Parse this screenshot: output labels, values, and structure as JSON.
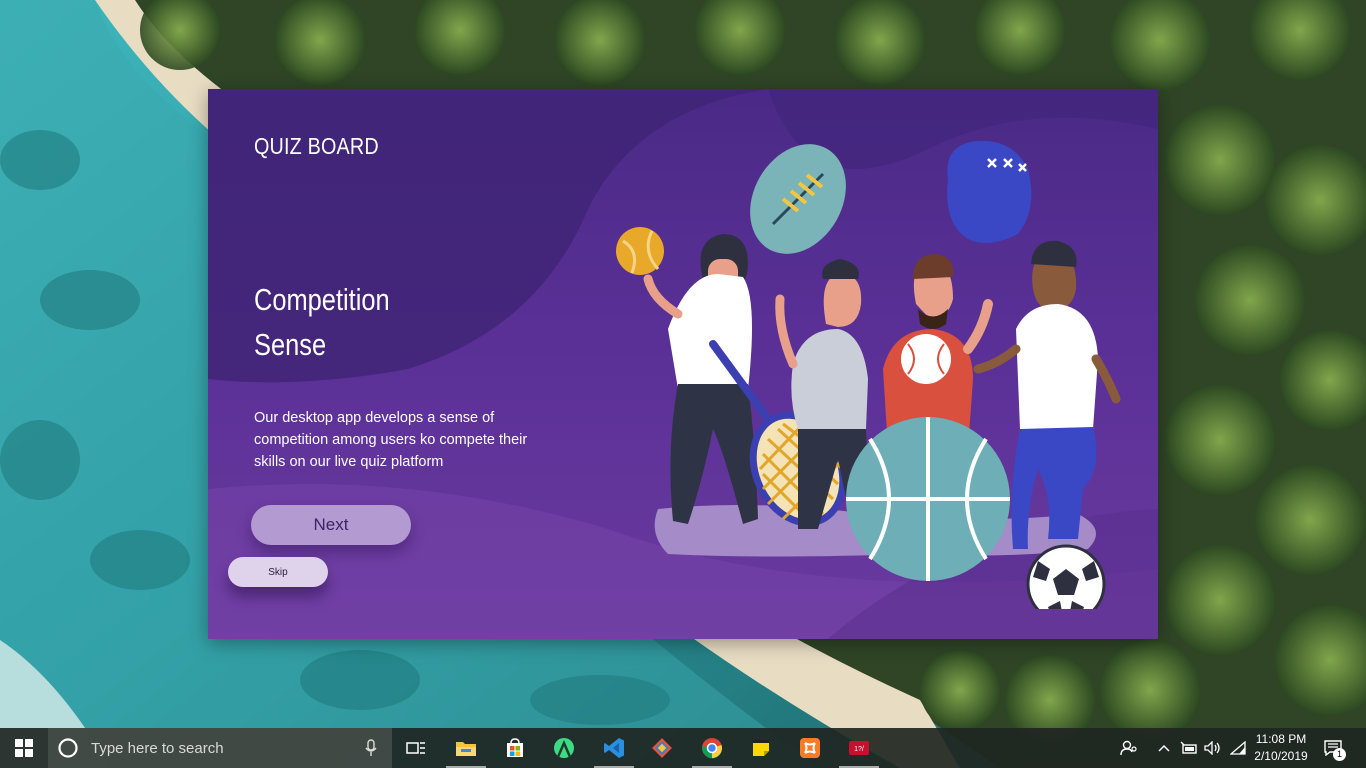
{
  "app": {
    "title": "QUIZ BOARD",
    "heading_line1": "Competition",
    "heading_line2": "Sense",
    "description": "Our desktop app develops a sense of competition among users ko compete their skills on our live quiz platform",
    "next_label": "Next",
    "skip_label": "Skip",
    "colors": {
      "accent": "#b39ad0",
      "skip": "#ded3ea",
      "background": "#5a3096"
    }
  },
  "taskbar": {
    "search_placeholder": "Type here to search",
    "time": "11:08 PM",
    "date": "2/10/2019",
    "notification_count": "1",
    "pinned_apps": [
      "task-view-icon",
      "file-explorer-icon",
      "store-icon",
      "android-studio-icon",
      "vscode-icon",
      "git-icon",
      "chrome-icon",
      "sticky-notes-icon",
      "xampp-icon",
      "terminal-icon"
    ]
  }
}
